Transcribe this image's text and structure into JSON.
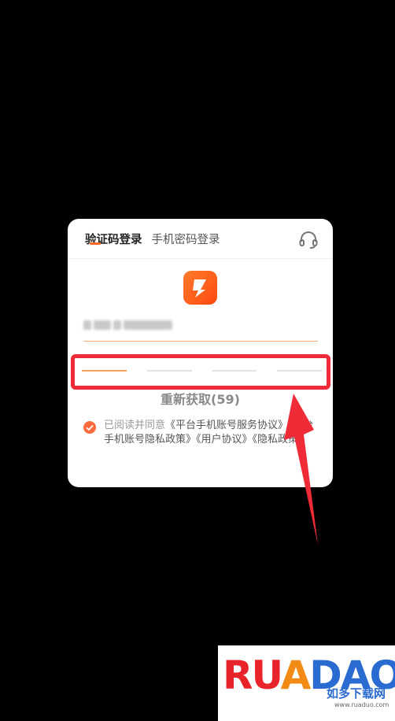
{
  "login": {
    "tabs": [
      {
        "label": "验证码登录",
        "active": true
      },
      {
        "label": "手机密码登录",
        "active": false
      }
    ],
    "support_icon": "headset-icon",
    "app_icon": "app-logo-icon",
    "phone_number_masked": "",
    "code_digits": 4,
    "resend_label": "重新获取(59)",
    "agreement": {
      "prefix": "已阅读并同意",
      "links": [
        "《平台手机账号服务协议》",
        "《平台手机账号隐私政策》",
        "《用户协议》",
        "《隐私政策》"
      ],
      "checked": true
    }
  },
  "colors": {
    "accent": "#ff6a22",
    "annotation": "#ee2b36"
  },
  "watermark": {
    "brand": "RUANDAO",
    "tagline": "如多下载网",
    "url": "www.ruaduo.com"
  }
}
